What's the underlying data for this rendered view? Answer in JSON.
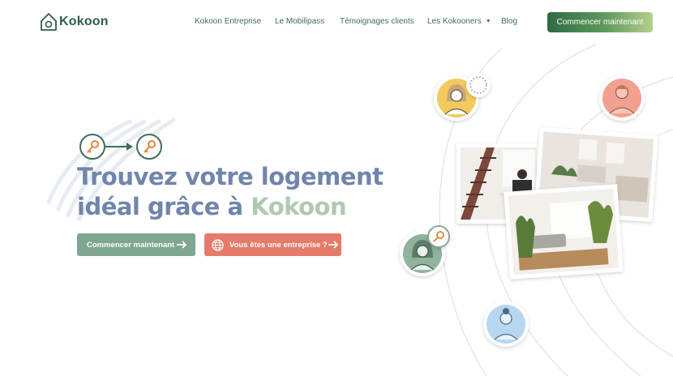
{
  "header": {
    "brand": "Kokoon",
    "nav": [
      {
        "label": "Kokoon Entreprise"
      },
      {
        "label": "Le Mobilipass"
      },
      {
        "label": "Témoignages clients"
      },
      {
        "label": "Les Kokooners",
        "has_dropdown": true
      },
      {
        "label": "Blog"
      }
    ],
    "cta_label": "Commencer maintenant"
  },
  "hero": {
    "title_line1": "Trouvez votre logement",
    "title_line2_prefix": "idéal grâce à ",
    "title_line2_brand": "Kokoon",
    "primary_button": "Commencer maintenant",
    "secondary_button": "Vous êtes une entreprise ?"
  },
  "icons": [
    "house-logo-icon",
    "key-icon",
    "arrow-right-icon",
    "globe-icon",
    "search-icon",
    "avatar-icon"
  ],
  "colors": {
    "brand_green": "#2f5e46",
    "nav_text": "#3f6e57",
    "title_blue": "#7085ad",
    "title_brand": "#b0c9b0",
    "button_green": "#7ea690",
    "button_red": "#e57b68",
    "key_orange": "#e8843a",
    "avatar_yellow": "#f4c95d",
    "avatar_pink": "#f2a08f",
    "avatar_sage": "#8fb39d",
    "avatar_blue": "#b7d6f0"
  }
}
